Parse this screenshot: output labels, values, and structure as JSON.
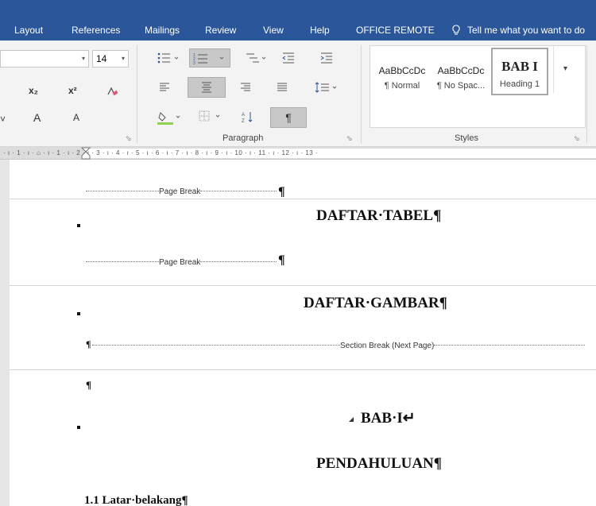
{
  "tabs": [
    {
      "label": "Layout"
    },
    {
      "label": "References"
    },
    {
      "label": "Mailings"
    },
    {
      "label": "Review"
    },
    {
      "label": "View"
    },
    {
      "label": "Help"
    },
    {
      "label": "OFFICE REMOTE"
    }
  ],
  "tell_me": "Tell me what you want to do",
  "font": {
    "size": "14",
    "subscript": "x₂",
    "superscript": "x²",
    "grow": "A",
    "shrink": "A"
  },
  "paragraph_group": {
    "label": "Paragraph",
    "pilcrow": "¶"
  },
  "styles_group": {
    "label": "Styles",
    "styles": [
      {
        "preview": "AaBbCcDc",
        "name": "¶ Normal"
      },
      {
        "preview": "AaBbCcDc",
        "name": "¶ No Spac..."
      },
      {
        "preview": "BAB I",
        "name": "Heading 1"
      }
    ]
  },
  "ruler": {
    "numbers": "· ı · 1 · ı · ⌂ · ı · 1 · ı · 2 · ı · 3 · ı · 4 · ı · 5 · ı · 6 · ı · 7 · ı · 8 · ı · 9 · ı · 10 · ı · 11 · ı · 12 · ı · 13 ·"
  },
  "document": {
    "page_break": "Page Break",
    "section_break": "Section Break (Next Page)",
    "pilcrow": "¶",
    "headings": {
      "daftar_tabel": "DAFTAR·TABEL¶",
      "daftar_gambar": "DAFTAR·GAMBAR¶",
      "bab": "BAB·I↵",
      "pendahuluan": "PENDAHULUAN¶"
    },
    "subheading": "1.1 Latar·belakang¶"
  },
  "colors": {
    "ribbon_blue": "#2b579a",
    "ribbon_body": "#f3f3f3",
    "doc_background": "#ffffff"
  }
}
